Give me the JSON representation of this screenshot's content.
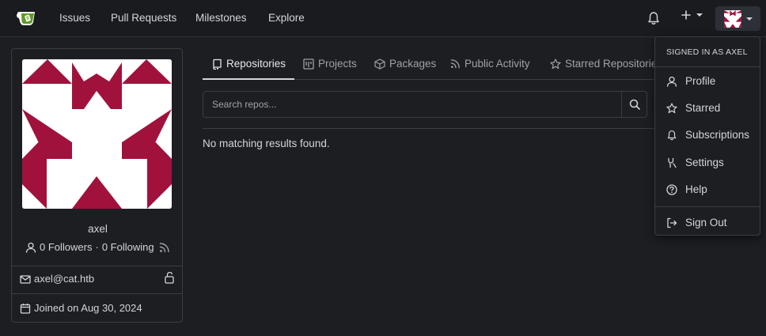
{
  "nav": {
    "links": [
      "Issues",
      "Pull Requests",
      "Milestones",
      "Explore"
    ]
  },
  "profile": {
    "username": "axel",
    "followers": "0 Followers",
    "separator": "·",
    "following": "0 Following",
    "email": "axel@cat.htb",
    "joined": "Joined on Aug 30, 2024"
  },
  "tabs": [
    {
      "label": "Repositories",
      "icon": "repo-icon"
    },
    {
      "label": "Projects",
      "icon": "project-icon"
    },
    {
      "label": "Packages",
      "icon": "package-icon"
    },
    {
      "label": "Public Activity",
      "icon": "rss-icon"
    },
    {
      "label": "Starred Repositories",
      "icon": "star-icon"
    }
  ],
  "search": {
    "placeholder": "Search repos..."
  },
  "results": {
    "empty_text": "No matching results found."
  },
  "dropdown": {
    "header": "SIGNED IN AS AXEL",
    "items": [
      {
        "label": "Profile",
        "icon": "person-icon"
      },
      {
        "label": "Starred",
        "icon": "star-icon"
      },
      {
        "label": "Subscriptions",
        "icon": "bell-icon"
      },
      {
        "label": "Settings",
        "icon": "tools-icon"
      },
      {
        "label": "Help",
        "icon": "question-icon"
      },
      {
        "label": "Sign Out",
        "icon": "sign-out-icon"
      }
    ]
  },
  "colors": {
    "background": "#1c1e22",
    "navbar": "#191b1f",
    "border": "#3a3d43",
    "text": "#d3d5d9",
    "muted": "#9ea2a9",
    "avatar_accent": "#a0123c",
    "logo_green": "#609926"
  }
}
